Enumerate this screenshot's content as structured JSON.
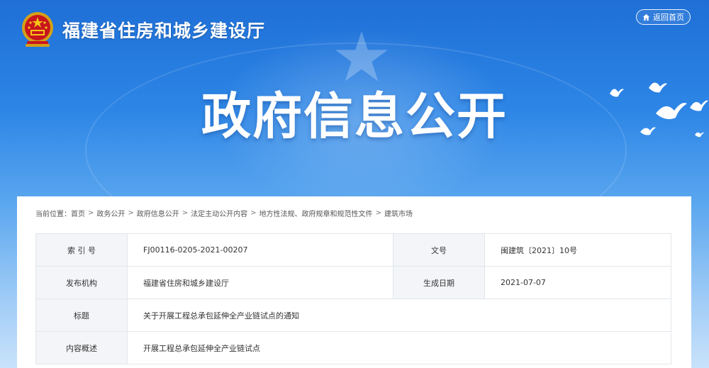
{
  "header": {
    "site_title": "福建省住房和城乡建设厅",
    "back_label": "返回首页"
  },
  "banner": {
    "title": "政府信息公开"
  },
  "breadcrumb": {
    "prefix": "当前位置：",
    "items": [
      "首页",
      "政务公开",
      "政府信息公开",
      "法定主动公开内容",
      "地方性法规、政府规章和规范性文件",
      "建筑市场"
    ],
    "separator": ">"
  },
  "info": {
    "index_no_label": "索 引 号",
    "index_no": "FJ00116-0205-2021-00207",
    "doc_no_label": "文号",
    "doc_no": "闽建筑〔2021〕10号",
    "publisher_label": "发布机构",
    "publisher": "福建省住房和城乡建设厅",
    "date_label": "生成日期",
    "date": "2021-07-07",
    "title_label": "标题",
    "title": "关于开展工程总承包延伸全产业链试点的通知",
    "summary_label": "内容概述",
    "summary": "开展工程总承包延伸全产业链试点"
  },
  "colors": {
    "banner_top": "#1f6fd6",
    "banner_bottom": "#c9e2fb",
    "label_bg": "#f3f5f8",
    "border": "#e3e6ea"
  }
}
